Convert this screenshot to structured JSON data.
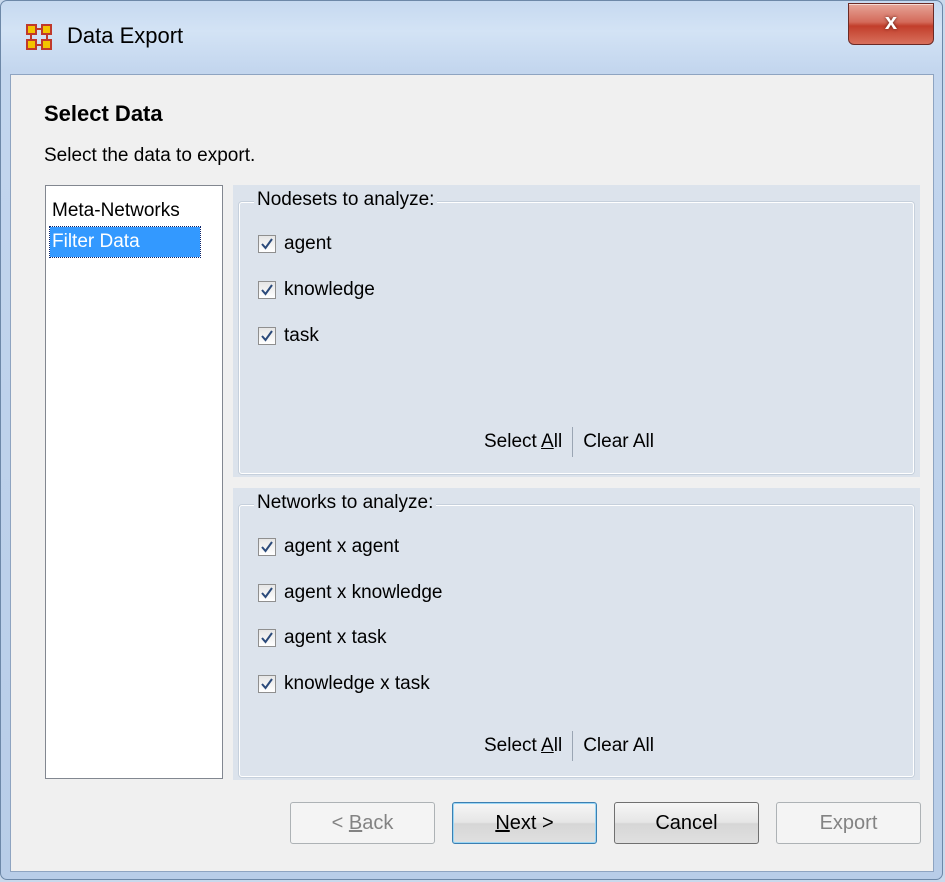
{
  "window": {
    "title": "Data Export",
    "close_label": "x"
  },
  "page": {
    "heading": "Select Data",
    "subheading": "Select the data to export."
  },
  "nav": {
    "items": [
      {
        "label": "Meta-Networks",
        "selected": false
      },
      {
        "label": "Filter Data",
        "selected": true
      }
    ]
  },
  "nodesets": {
    "title": "Nodesets to analyze:",
    "items": [
      {
        "label": "agent",
        "checked": true
      },
      {
        "label": "knowledge",
        "checked": true
      },
      {
        "label": "task",
        "checked": true
      }
    ],
    "select_all": "Select All",
    "clear_all": "Clear All"
  },
  "networks": {
    "title": "Networks to analyze:",
    "items": [
      {
        "label": "agent x agent",
        "checked": true
      },
      {
        "label": "agent x knowledge",
        "checked": true
      },
      {
        "label": "agent x task",
        "checked": true
      },
      {
        "label": "knowledge x task",
        "checked": true
      }
    ],
    "select_all": "Select All",
    "clear_all": "Clear All"
  },
  "buttons": {
    "back": "< Back",
    "next": "Next >",
    "cancel": "Cancel",
    "export": "Export"
  },
  "colors": {
    "selection": "#3399ff",
    "panel_bg": "#dce3ec"
  }
}
